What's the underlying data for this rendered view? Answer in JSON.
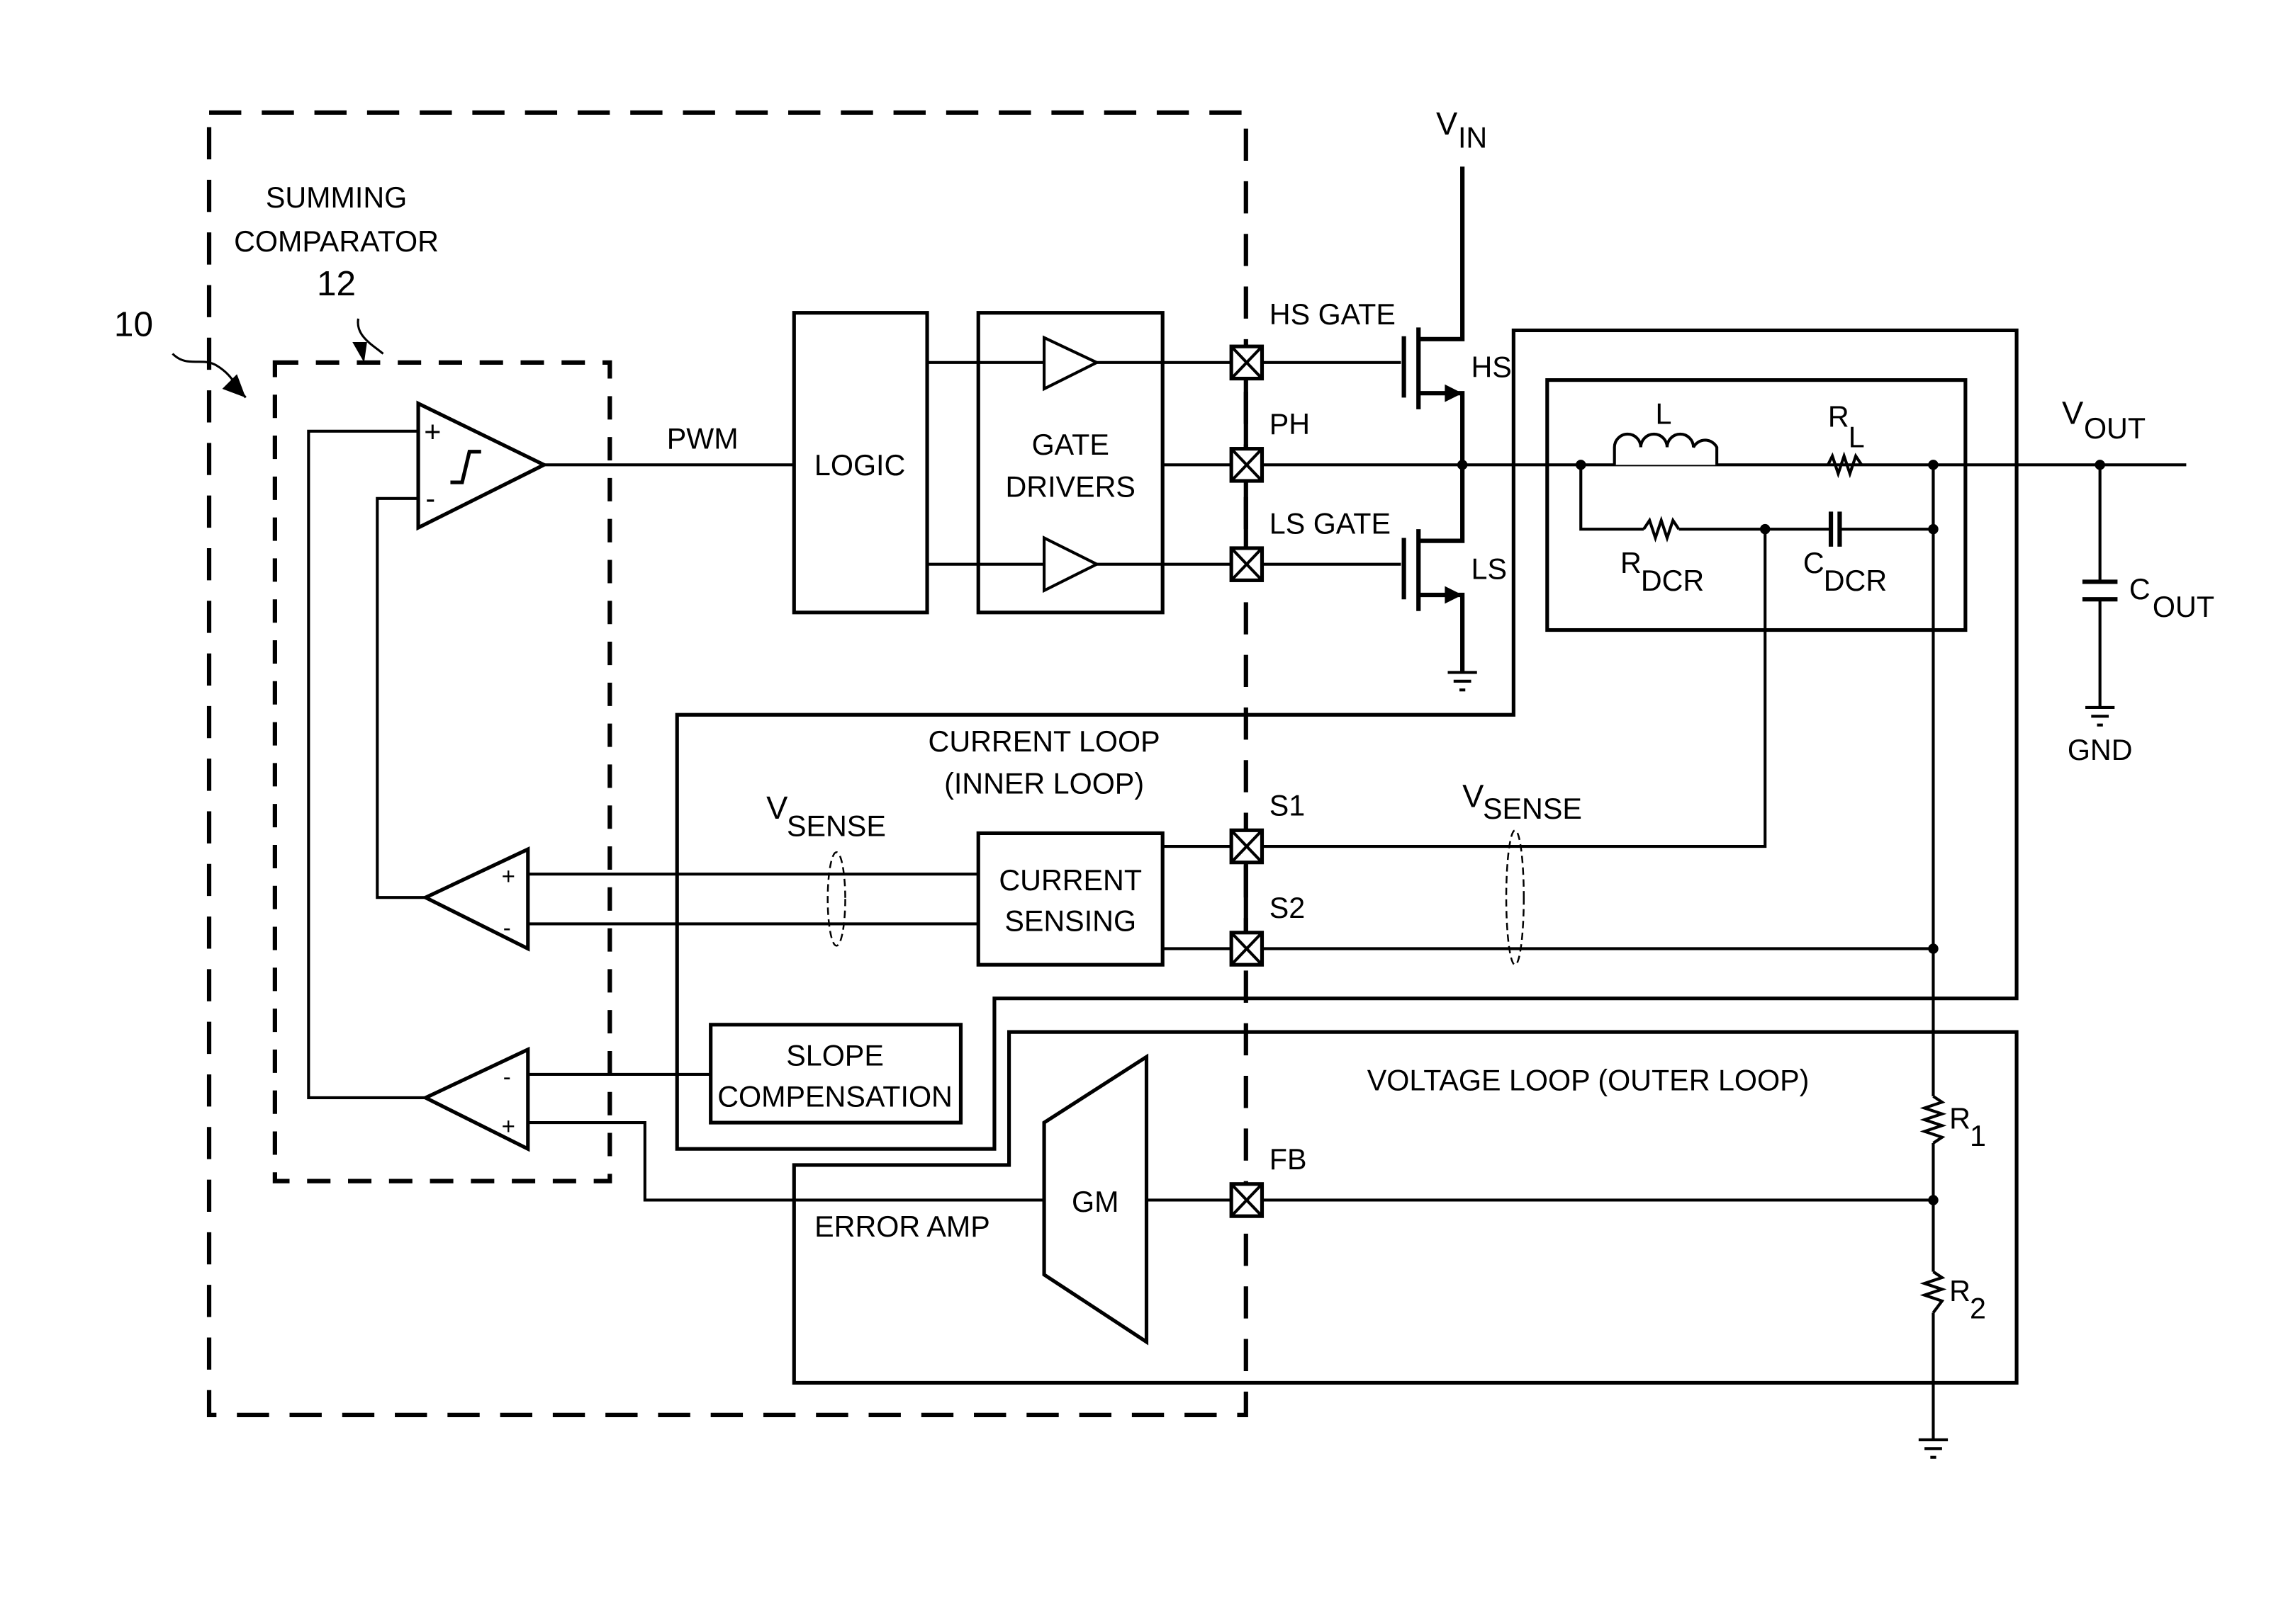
{
  "figure": {
    "ref_system": "10",
    "ref_comparator": "12",
    "summing_comparator": [
      "SUMMING",
      "COMPARATOR"
    ],
    "colors": {
      "ink": "#000000",
      "background": "#ffffff"
    }
  },
  "blocks": {
    "logic": "LOGIC",
    "gate_drivers": [
      "GATE",
      "DRIVERS"
    ],
    "current_sensing": [
      "CURRENT",
      "SENSING"
    ],
    "slope_compensation": [
      "SLOPE",
      "COMPENSATION"
    ],
    "gm": "GM",
    "error_amp": "ERROR AMP"
  },
  "signals": {
    "pwm": "PWM",
    "vin": {
      "main": "V",
      "sub": "IN"
    },
    "vout": {
      "main": "V",
      "sub": "OUT"
    },
    "vsense_left": {
      "main": "V",
      "sub": "SENSE"
    },
    "vsense_right": {
      "main": "V",
      "sub": "SENSE"
    },
    "gnd": "GND"
  },
  "pins": {
    "hs_gate": "HS GATE",
    "ph": "PH",
    "ls_gate": "LS GATE",
    "s1": "S1",
    "s2": "S2",
    "fb": "FB"
  },
  "components": {
    "hs": "HS",
    "ls": "LS",
    "inductor": "L",
    "rl": {
      "main": "R",
      "sub": "L"
    },
    "rdcr": {
      "main": "R",
      "sub": "DCR"
    },
    "cdcr": {
      "main": "C",
      "sub": "DCR"
    },
    "cout": {
      "main": "C",
      "sub": "OUT"
    },
    "r1": {
      "main": "R",
      "sub": "1"
    },
    "r2": {
      "main": "R",
      "sub": "2"
    }
  },
  "loops": {
    "current_loop": [
      "CURRENT LOOP",
      "(INNER LOOP)"
    ],
    "voltage_loop": "VOLTAGE LOOP (OUTER LOOP)"
  },
  "comparator_signs": {
    "plus": "+",
    "minus": "-"
  }
}
